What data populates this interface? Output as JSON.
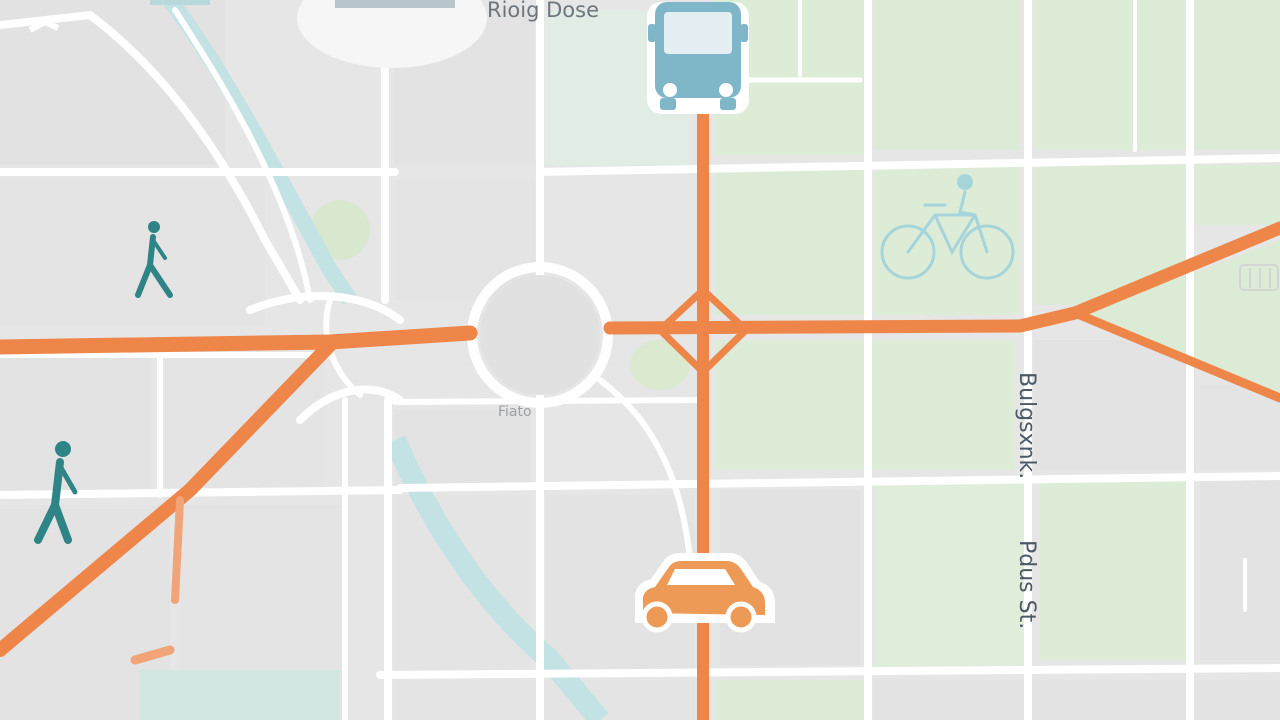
{
  "map": {
    "colors": {
      "background": "#e8e8e8",
      "block": "#e0e0e0",
      "park": "#dcecd6",
      "water": "#bfe0e4",
      "road": "#ffffff",
      "route": "#ee8549",
      "icon_teal": "#2f8486",
      "bus_blue": "#80b8cb",
      "bike_blue": "#a8d6dd",
      "car_orange": "#ee9a57"
    },
    "labels": {
      "top_label": "Rioig Dose",
      "roundabout_label": "Fiato",
      "vertical_street_a": "Bulgsxnk.",
      "vertical_street_b": "Pdus St."
    },
    "icons": {
      "bus": "bus-icon",
      "bicycle": "bicycle-icon",
      "car": "car-icon",
      "pedestrian_upper": "pedestrian-icon",
      "pedestrian_lower": "pedestrian-icon"
    }
  }
}
